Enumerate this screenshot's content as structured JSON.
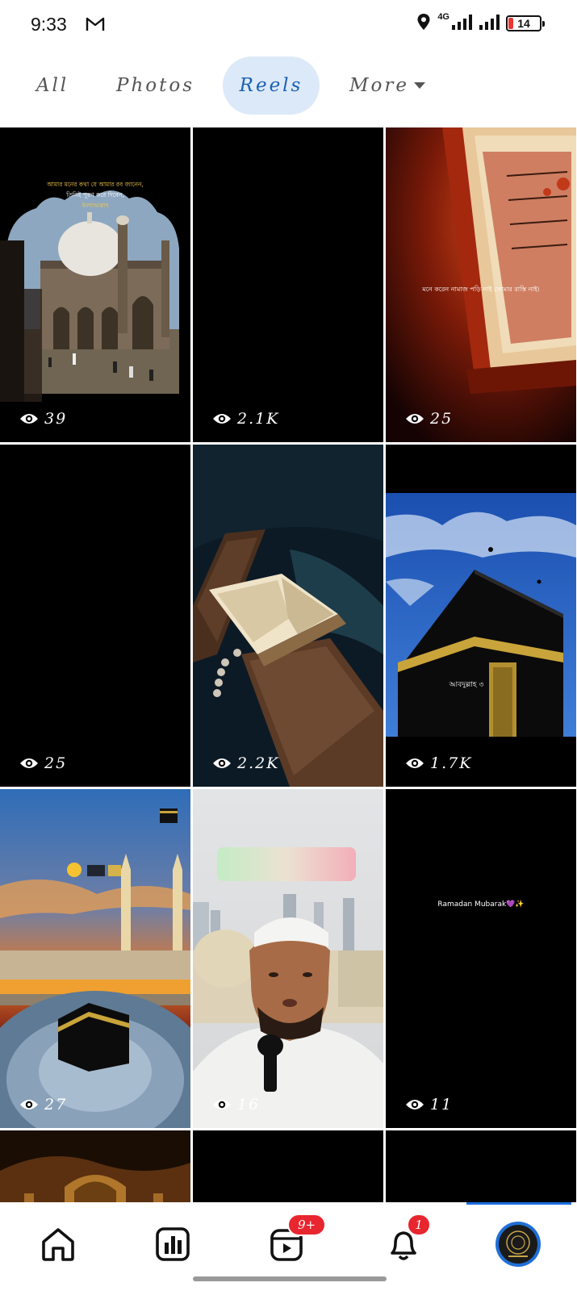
{
  "status_bar": {
    "time": "9:33",
    "network": "4G",
    "battery": "14",
    "battery_level_percent": 14
  },
  "tabs": {
    "all": "All",
    "photos": "Photos",
    "reels": "Reels",
    "more": "More",
    "active": "Reels"
  },
  "reels": [
    {
      "views": "39",
      "overlay_lines": [
        "আমার মনের কথা যে আমার রব জানেন,",
        "তিনিই পূরণ করে দিবেন,",
        "ইনশাআল্লাহ"
      ],
      "scene": "mosque"
    },
    {
      "views": "2.1K",
      "scene": "black"
    },
    {
      "views": "25",
      "overlay_lines": [
        "মনে করেন নামাজ পড়ি নাই তোমার রাস্তি নাই।"
      ],
      "scene": "quran-red"
    },
    {
      "views": "25",
      "scene": "black"
    },
    {
      "views": "2.2K",
      "scene": "quran-stand"
    },
    {
      "views": "1.7K",
      "overlay_lines": [
        "আবদুল্লাহ ৩"
      ],
      "scene": "kaaba-sky"
    },
    {
      "views": "27",
      "scene": "kaaba-sunset"
    },
    {
      "views": "16",
      "scene": "selfie"
    },
    {
      "views": "11",
      "overlay_lines": [
        "Ramadan Mubarak💜✨"
      ],
      "scene": "black-text"
    }
  ],
  "bottom_nav": {
    "home": "home",
    "dashboard": "dashboard",
    "reels_badge": "9+",
    "notifications_badge": "1",
    "profile": "profile"
  },
  "colors": {
    "accent": "#1a5fb4",
    "active_tab_bg": "#dce9f8",
    "badge": "#e8262f"
  }
}
